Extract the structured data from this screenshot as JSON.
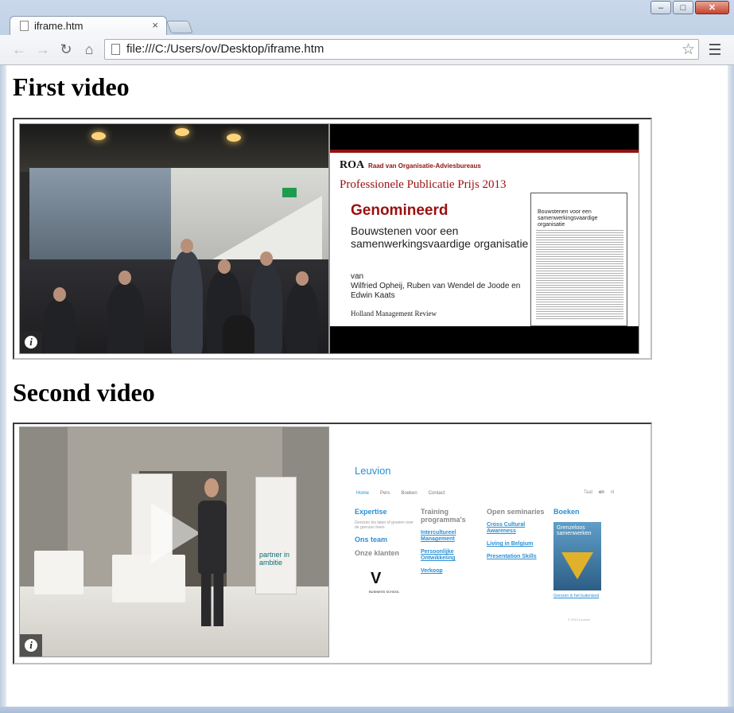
{
  "window": {
    "minimize_label": "–",
    "maximize_label": "□",
    "close_label": "✕"
  },
  "tab": {
    "title": "iframe.htm",
    "close_glyph": "×"
  },
  "toolbar": {
    "back_glyph": "←",
    "forward_glyph": "→",
    "reload_glyph": "↻",
    "home_glyph": "⌂",
    "url": "file:///C:/Users/ov/Desktop/iframe.htm",
    "star_glyph": "☆"
  },
  "page": {
    "heading_first": "First video",
    "heading_second": "Second video"
  },
  "video1": {
    "info_glyph": "i"
  },
  "slide": {
    "org_abbr": "ROA",
    "org_name": "Raad van Organisatie-Adviesbureaus",
    "prize": "Professionele Publicatie Prijs 2013",
    "status": "Genomineerd",
    "title": "Bouwstenen voor een samenwerkingsvaardige organisatie",
    "authors_prefix": "van",
    "authors": "Wilfried Opheij, Ruben van Wendel de Joode en Edwin Kaats",
    "journal": "Holland Management Review",
    "thumb_title": "Bouwstenen voor een samenwerkingsvaardige organisatie"
  },
  "video3": {
    "banner_text": "partner in ambitie",
    "info_glyph": "i"
  },
  "site": {
    "logo": "Leuvion",
    "nav": [
      "Home",
      "Pers",
      "Boeken",
      "Contact"
    ],
    "lang": [
      "Taal",
      "en",
      "nl"
    ],
    "col1": {
      "heading": "Expertise",
      "small": "Grenzen los laten of groeien over de grenzen heen",
      "link1": "Ons team",
      "sub": "Onze klanten"
    },
    "col2": {
      "heading": "Training programma's",
      "links": [
        "Intercultureel Management",
        "Persoonlijke Ontwikkeling",
        "Verkoop"
      ]
    },
    "col3": {
      "heading": "Open seminaries",
      "links": [
        "Cross Cultural Awareness",
        "Living in Belgium",
        "Presentation Skills"
      ]
    },
    "col4": {
      "heading": "Boeken",
      "book_title": "Grenzeloos samenwerken",
      "book_link": "Grenzen in het buitenland"
    },
    "client_logo": "V",
    "client_sub": "BUSINESS SCHOOL",
    "copyright": "© 2013 Leuvion"
  }
}
